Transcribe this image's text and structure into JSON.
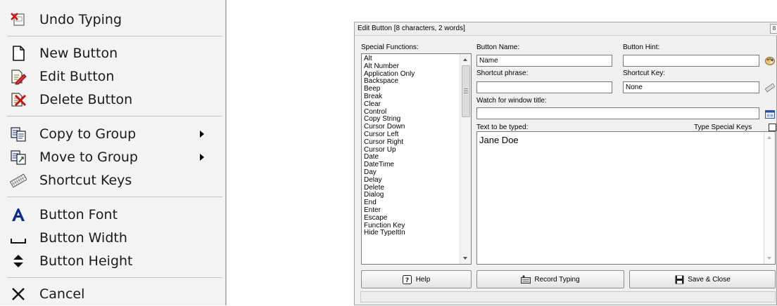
{
  "menu": {
    "items": [
      {
        "label": "Undo Typing",
        "icon": "undo-typing-icon"
      },
      {
        "label": "New Button",
        "icon": "new-button-icon"
      },
      {
        "label": "Edit Button",
        "icon": "edit-button-icon"
      },
      {
        "label": "Delete Button",
        "icon": "delete-button-icon"
      },
      {
        "label": "Copy to Group",
        "icon": "copy-to-group-icon",
        "submenu": true
      },
      {
        "label": "Move to Group",
        "icon": "move-to-group-icon",
        "submenu": true
      },
      {
        "label": "Shortcut Keys",
        "icon": "shortcut-keys-icon"
      },
      {
        "label": "Button Font",
        "icon": "button-font-icon"
      },
      {
        "label": "Button Width",
        "icon": "button-width-icon"
      },
      {
        "label": "Button Height",
        "icon": "button-height-icon"
      },
      {
        "label": "Cancel",
        "icon": "cancel-icon"
      }
    ]
  },
  "dialog": {
    "title": "Edit Button [8 characters, 2 words]",
    "special_functions_label": "Special Functions:",
    "special_functions": [
      "Alt",
      "Alt Number",
      "Application Only",
      "Backspace",
      "Beep",
      "Break",
      "Clear",
      "Control",
      "Copy String",
      "Cursor Down",
      "Cursor Left",
      "Cursor Right",
      "Cursor Up",
      "Date",
      "DateTime",
      "Day",
      "Delay",
      "Delete",
      "Dialog",
      "End",
      "Enter",
      "Escape",
      "Function Key",
      "Hide TypeItIn"
    ],
    "button_name_label": "Button Name:",
    "button_name_value": "Name",
    "button_hint_label": "Button Hint:",
    "button_hint_value": "",
    "shortcut_phrase_label": "Shortcut phrase:",
    "shortcut_phrase_value": "",
    "shortcut_key_label": "Shortcut Key:",
    "shortcut_key_value": "None",
    "watch_window_label": "Watch for window title:",
    "watch_window_value": "",
    "text_label": "Text to be typed:",
    "text_value": "Jane Doe",
    "type_special_keys_label": "Type Special Keys",
    "type_special_keys_checked": false,
    "buttons": {
      "help": "Help",
      "record": "Record Typing",
      "save": "Save & Close"
    }
  }
}
